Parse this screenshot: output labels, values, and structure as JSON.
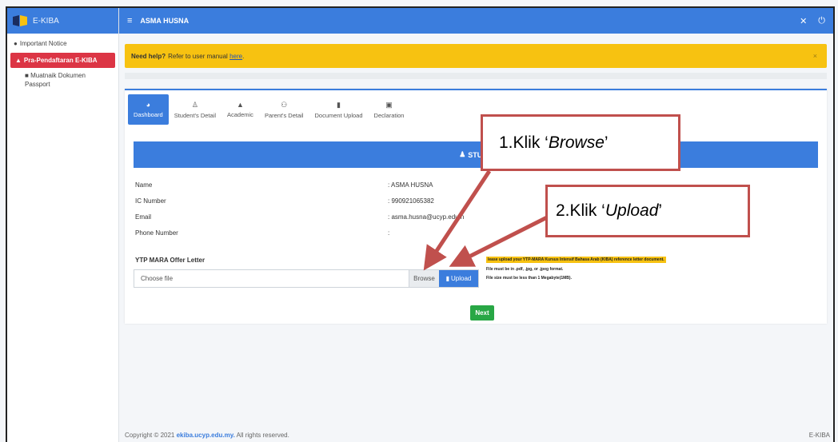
{
  "brand": {
    "name": "E-KIBA"
  },
  "topbar": {
    "user": "ASMA HUSNA",
    "menu_icon": "≡",
    "settings_icon": "✕",
    "power_icon": "⏻"
  },
  "sidebar": {
    "items": [
      {
        "label": "Important Notice",
        "icon": "info-circle"
      },
      {
        "label": "Pra-Pendaftaran E-KIBA",
        "icon": "graduation"
      },
      {
        "label": "Muatnaik Dokumen Passport",
        "icon": "book"
      }
    ]
  },
  "alert": {
    "bold": "Need help?",
    "text": "Refer to user manual",
    "link": "here",
    "after": ".",
    "close": "×"
  },
  "tabs": [
    {
      "label": "Dashboard",
      "active": true
    },
    {
      "label": "Student's Detail"
    },
    {
      "label": "Academic"
    },
    {
      "label": "Parent's Detail"
    },
    {
      "label": "Document Upload"
    },
    {
      "label": "Declaration"
    }
  ],
  "header": {
    "title": "STUDE"
  },
  "info": [
    {
      "label": "Name",
      "value": ": ASMA HUSNA"
    },
    {
      "label": "IC Number",
      "value": ": 990921065382"
    },
    {
      "label": "Email",
      "value": ": asma.husna@ucyp.edu.n"
    },
    {
      "label": "Phone Number",
      "value": ":"
    }
  ],
  "upload": {
    "label": "YTP MARA Offer Letter",
    "placeholder": "Choose file",
    "browse": "Browse",
    "upload": "Upload"
  },
  "notes": [
    "lease upload your YTP-MARA Kursus Intensif Bahasa Arab (KIBA) reference letter document.",
    "File must be in .pdf, .jpg, or .jpeg format.",
    "File size must be less than 1 Megabyte(1MB)."
  ],
  "next_button": "Next",
  "footer": {
    "prefix": "Copyright © 2021",
    "link": "ekiba.ucyp.edu.my.",
    "suffix": "All rights reserved.",
    "right": "E-KIBA"
  },
  "callouts": {
    "step1": {
      "prefix": "1.Klik ‘",
      "emph": "Browse",
      "suffix": "’"
    },
    "step2": {
      "prefix": "2.Klik ‘",
      "emph": "Upload",
      "suffix": "’"
    }
  },
  "colors": {
    "primary": "#3b7ddd",
    "danger": "#dc3545",
    "warning": "#f7c211",
    "success": "#28a745",
    "callout_border": "#c0504d"
  }
}
